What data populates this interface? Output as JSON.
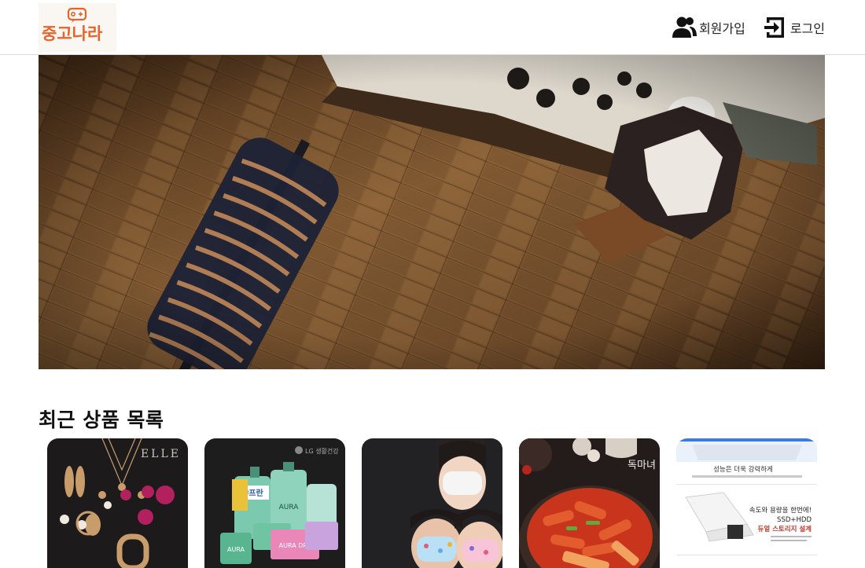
{
  "header": {
    "logo_text": "중고나라",
    "nav": [
      {
        "label": "회원가입",
        "icon": "users-icon"
      },
      {
        "label": "로그인",
        "icon": "login-icon"
      }
    ]
  },
  "hero": {
    "icon": "clothing-store-floor-photo"
  },
  "section": {
    "title": "최근 상품 목록"
  },
  "products": [
    {
      "image": "jewelry-product-photo",
      "overlay_text": "ELLE"
    },
    {
      "image": "detergent-product-photo",
      "overlay_text": "LG 생활건강",
      "pack_labels": [
        "샤프란",
        "AURA",
        "AURA",
        "AURA DRY"
      ]
    },
    {
      "image": "kids-mask-product-photo"
    },
    {
      "image": "tteokbokki-product-photo",
      "overlay_text": "독마녀"
    },
    {
      "image": "laptop-product-photo",
      "lines": [
        "성능은 더욱 강력하게",
        "속도와 용량을 한번에!",
        "SSD+HDD",
        "듀얼 스토리지 설계"
      ]
    }
  ],
  "colors": {
    "logo_orange": "#e8632a",
    "header_border": "#dcdcdc",
    "text": "#111111"
  }
}
